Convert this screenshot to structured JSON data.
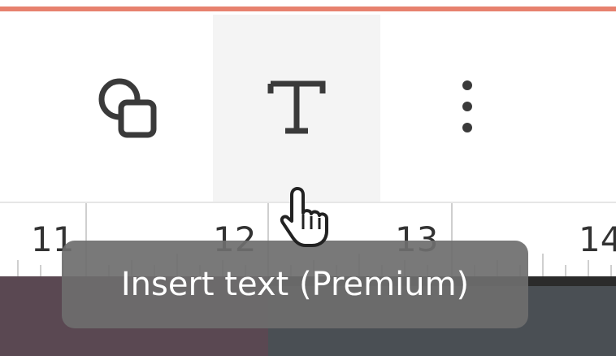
{
  "toolbar": {
    "tools": [
      {
        "name": "shapes",
        "icon": "shapes-icon"
      },
      {
        "name": "text",
        "icon": "text-icon",
        "hovered": true
      },
      {
        "name": "more",
        "icon": "more-vertical-icon"
      }
    ]
  },
  "ruler": {
    "labels": [
      "11",
      "12",
      "13",
      "14"
    ]
  },
  "tooltip": {
    "text": "Insert text (Premium)"
  },
  "colors": {
    "accent_border": "#e4735e",
    "tooltip_bg": "#6e6e6e",
    "hover_bg": "#f4f4f4"
  }
}
